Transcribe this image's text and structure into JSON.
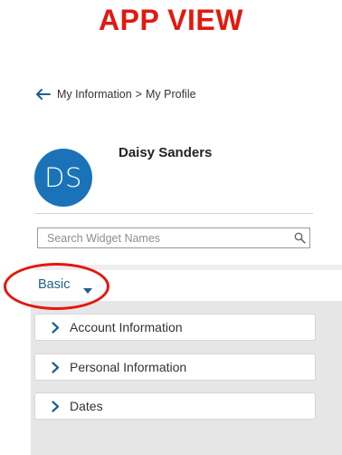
{
  "banner": {
    "title": "APP VIEW"
  },
  "breadcrumb": {
    "parent": "My Information",
    "separator": ">",
    "current": "My Profile"
  },
  "profile": {
    "initials": "DS",
    "name": "Daisy Sanders"
  },
  "search": {
    "placeholder": "Search Widget Names",
    "value": ""
  },
  "view_selector": {
    "selected": "Basic"
  },
  "sections": [
    {
      "label": "Account Information"
    },
    {
      "label": "Personal Information"
    },
    {
      "label": "Dates"
    }
  ],
  "colors": {
    "banner": "#e3180f",
    "avatar": "#1a73b8",
    "link": "#1f5f8b",
    "highlight": "#e3180f"
  },
  "icons": {
    "back": "arrow-left-icon",
    "search": "search-icon",
    "dropdown": "caret-down-icon",
    "expand": "chevron-right-icon"
  }
}
